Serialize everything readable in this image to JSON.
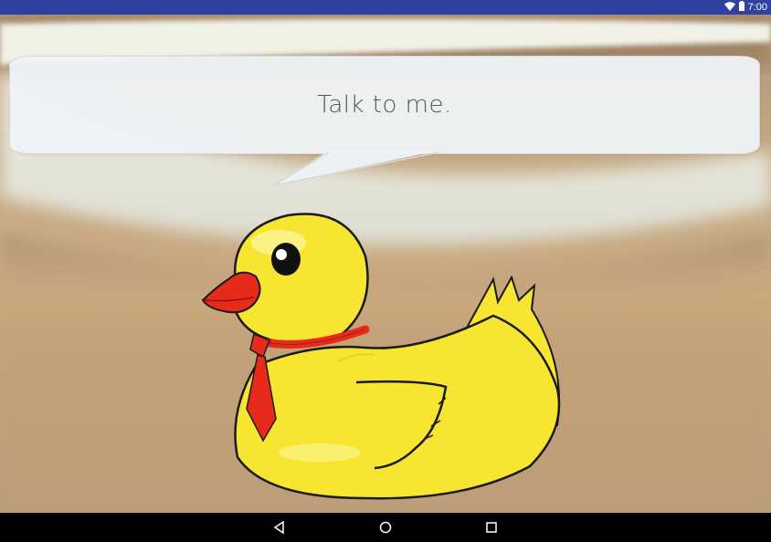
{
  "status_bar": {
    "time": "7:00",
    "icons": [
      "wifi-icon",
      "battery-icon"
    ],
    "color": "#3041a0"
  },
  "speech_bubble": {
    "text": "Talk to me."
  },
  "character": {
    "name": "rubber-duck",
    "colors": {
      "body": "#f7e531",
      "beak": "#e82a1a",
      "tie": "#e82a1a"
    }
  },
  "navigation_bar": {
    "buttons": [
      "back-icon",
      "home-icon",
      "recents-icon"
    ]
  }
}
